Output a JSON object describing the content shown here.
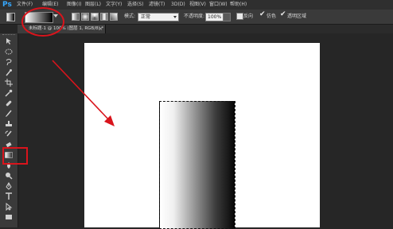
{
  "app": {
    "logo": "Ps"
  },
  "menu": [
    {
      "label": "文件(F)"
    },
    {
      "label": "编辑(E)"
    },
    {
      "label": "图像(I)"
    },
    {
      "label": "图层(L)"
    },
    {
      "label": "文字(Y)"
    },
    {
      "label": "选择(S)"
    },
    {
      "label": "滤镜(T)"
    },
    {
      "label": "3D(D)"
    },
    {
      "label": "视图(V)"
    },
    {
      "label": "窗口(W)"
    },
    {
      "label": "帮助(H)"
    }
  ],
  "options": {
    "mode_label": "模式:",
    "mode_value": "正常",
    "opacity_label": "不透明度:",
    "opacity_value": "100%",
    "reverse_label": "反向",
    "dither_label": "仿色",
    "transparency_label": "透明区域",
    "gradient_colors": [
      "#ffffff",
      "#000000"
    ]
  },
  "document_tab": {
    "title": "未标题-1 @ 100% (图层 1, RGB/8) *",
    "close": "×"
  },
  "tools": [
    {
      "icon": "move-icon"
    },
    {
      "icon": "marquee-icon"
    },
    {
      "icon": "lasso-icon"
    },
    {
      "icon": "quick-selection-icon"
    },
    {
      "icon": "crop-icon"
    },
    {
      "icon": "eyedropper-icon"
    },
    {
      "icon": "healing-brush-icon"
    },
    {
      "icon": "brush-icon"
    },
    {
      "icon": "clone-stamp-icon"
    },
    {
      "icon": "history-brush-icon"
    },
    {
      "icon": "eraser-icon"
    },
    {
      "icon": "gradient-icon",
      "selected": true
    },
    {
      "icon": "blur-icon"
    },
    {
      "icon": "dodge-icon"
    },
    {
      "icon": "pen-icon"
    },
    {
      "icon": "type-icon"
    },
    {
      "icon": "path-selection-icon"
    },
    {
      "icon": "rectangle-shape-icon"
    }
  ],
  "annotation_color": "#d9141c"
}
